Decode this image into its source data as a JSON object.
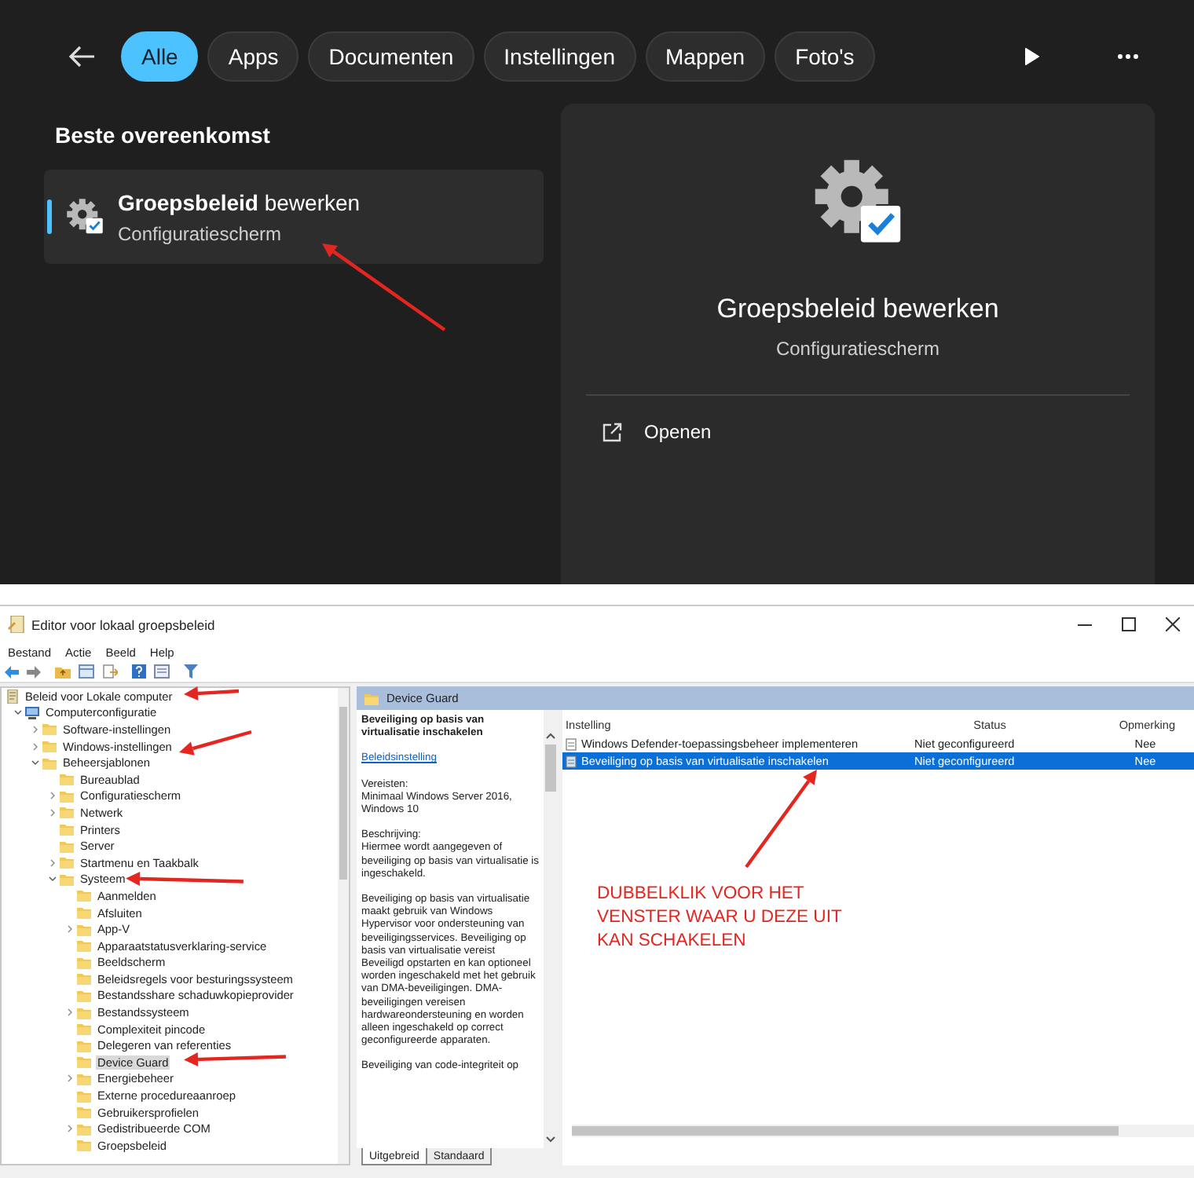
{
  "search": {
    "filters": [
      {
        "label": "Alle",
        "selected": true
      },
      {
        "label": "Apps",
        "selected": false
      },
      {
        "label": "Documenten",
        "selected": false
      },
      {
        "label": "Instellingen",
        "selected": false
      },
      {
        "label": "Mappen",
        "selected": false
      },
      {
        "label": "Foto's",
        "selected": false
      }
    ],
    "best_match": {
      "heading": "Beste overeenkomst",
      "result": {
        "title": "**Groepsbeleid** bewerken",
        "subtitle": "Configuratiescherm",
        "selected": true
      }
    },
    "preview": {
      "title": "Groepsbeleid bewerken",
      "subtitle": "Configuratiescherm",
      "actions": [
        {
          "label": "Openen"
        }
      ]
    }
  },
  "editor": {
    "window": {
      "title": "Editor voor lokaal groepsbeleid"
    },
    "menu": [
      "Bestand",
      "Actie",
      "Beeld",
      "Help"
    ],
    "tree": [
      {
        "label": "Beleid voor Lokale computer",
        "kind": "policy",
        "selected": false,
        "children": [
          {
            "label": "Computerconfiguratie",
            "kind": "computer",
            "expanded": true,
            "selected": false,
            "children": [
              {
                "label": "Software-instellingen",
                "kind": "folder",
                "expanded": false,
                "selected": false
              },
              {
                "label": "Windows-instellingen",
                "kind": "folder",
                "expanded": false,
                "selected": false
              },
              {
                "label": "Beheersjablonen",
                "kind": "folder",
                "expanded": true,
                "selected": false,
                "children": [
                  {
                    "label": "Bureaublad",
                    "kind": "folder",
                    "selected": false
                  },
                  {
                    "label": "Configuratiescherm",
                    "kind": "folder",
                    "expanded": false,
                    "selected": false
                  },
                  {
                    "label": "Netwerk",
                    "kind": "folder",
                    "expanded": false,
                    "selected": false
                  },
                  {
                    "label": "Printers",
                    "kind": "folder",
                    "selected": false
                  },
                  {
                    "label": "Server",
                    "kind": "folder",
                    "selected": false
                  },
                  {
                    "label": "Startmenu en Taakbalk",
                    "kind": "folder",
                    "expanded": false,
                    "selected": false
                  },
                  {
                    "label": "Systeem",
                    "kind": "folder",
                    "expanded": true,
                    "selected": false,
                    "children": [
                      {
                        "label": "Aanmelden",
                        "kind": "folder",
                        "selected": false
                      },
                      {
                        "label": "Afsluiten",
                        "kind": "folder",
                        "selected": false
                      },
                      {
                        "label": "App-V",
                        "kind": "folder",
                        "expanded": false,
                        "selected": false
                      },
                      {
                        "label": "Apparaatstatusverklaring-service",
                        "kind": "folder",
                        "selected": false
                      },
                      {
                        "label": "Beeldscherm",
                        "kind": "folder",
                        "selected": false
                      },
                      {
                        "label": "Beleidsregels voor besturingssysteem",
                        "kind": "folder",
                        "selected": false
                      },
                      {
                        "label": "Bestandsshare schaduwkopieprovider",
                        "kind": "folder",
                        "selected": false
                      },
                      {
                        "label": "Bestandssysteem",
                        "kind": "folder",
                        "expanded": false,
                        "selected": false
                      },
                      {
                        "label": "Complexiteit pincode",
                        "kind": "folder",
                        "selected": false
                      },
                      {
                        "label": "Delegeren van referenties",
                        "kind": "folder",
                        "selected": false
                      },
                      {
                        "label": "Device Guard",
                        "kind": "folder",
                        "selected": true
                      },
                      {
                        "label": "Energiebeheer",
                        "kind": "folder",
                        "expanded": false,
                        "selected": false
                      },
                      {
                        "label": "Externe procedureaanroep",
                        "kind": "folder",
                        "selected": false
                      },
                      {
                        "label": "Gebruikersprofielen",
                        "kind": "folder",
                        "selected": false
                      },
                      {
                        "label": "Gedistribueerde COM",
                        "kind": "folder",
                        "expanded": false,
                        "selected": false
                      },
                      {
                        "label": "Groepsbeleid",
                        "kind": "folder",
                        "selected": false
                      }
                    ]
                  }
                ]
              }
            ]
          }
        ]
      }
    ],
    "details": {
      "header": "Device Guard",
      "policy_title": "Beveiliging op basis van virtualisatie inschakelen",
      "link": "Beleidsinstelling",
      "paragraphs": [
        "Vereisten:\nMinimaal Windows Server 2016, Windows 10",
        "Beschrijving:\nHiermee wordt aangegeven of beveiliging op basis van virtualisatie is ingeschakeld.",
        "Beveiliging op basis van virtualisatie maakt gebruik van Windows Hypervisor voor ondersteuning van beveiligingsservices. Beveiliging op basis van virtualisatie vereist Beveiligd opstarten en kan optioneel worden ingeschakeld met het gebruik van DMA-beveiligingen. DMA-beveiligingen vereisen hardwareondersteuning en worden alleen ingeschakeld op correct geconfigureerde apparaten.",
        "Beveiliging van code-integriteit op"
      ],
      "columns": [
        "Instelling",
        "Status",
        "Opmerking"
      ],
      "rows": [
        {
          "setting": "Windows Defender-toepassingsbeheer implementeren",
          "status": "Niet geconfigureerd",
          "comment": "Nee",
          "selected": false
        },
        {
          "setting": "Beveiliging op basis van virtualisatie inschakelen",
          "status": "Niet geconfigureerd",
          "comment": "Nee",
          "selected": true
        }
      ],
      "tabs": [
        {
          "label": "Uitgebreid",
          "selected": true
        },
        {
          "label": "Standaard",
          "selected": false
        }
      ]
    },
    "annotation": "DUBBELKLIK VOOR HET VENSTER WAAR U DEZE UIT KAN SCHAKELEN"
  }
}
